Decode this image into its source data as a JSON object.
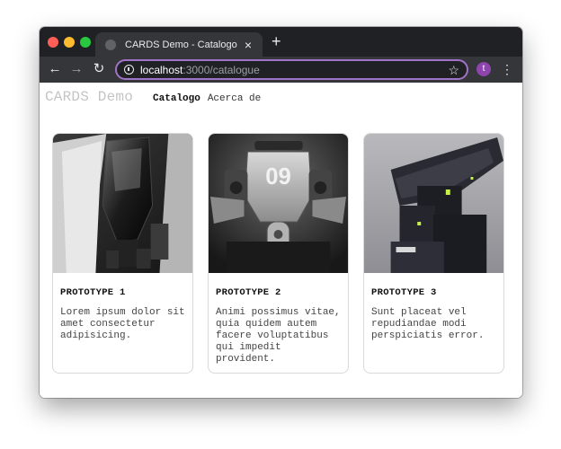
{
  "browser": {
    "tab_title": "CARDS Demo - Catalogo",
    "tab_close": "×",
    "new_tab": "+",
    "url_host": "localhost",
    "url_path": ":3000/catalogue",
    "profile_initial": "t"
  },
  "site": {
    "brand": "CARDS Demo",
    "nav": [
      "Catalogo",
      "Acerca de"
    ]
  },
  "cards": [
    {
      "title": "PROTOTYPE 1",
      "text": "Lorem ipsum dolor sit amet consectetur adipisicing."
    },
    {
      "title": "PROTOTYPE 2",
      "text": "Animi possimus vitae, quia quidem autem facere voluptatibus qui impedit provident."
    },
    {
      "title": "PROTOTYPE 3",
      "text": "Sunt placeat vel repudiandae modi perspiciatis error."
    }
  ],
  "card_images": [
    {
      "label": ""
    },
    {
      "label": "09"
    },
    {
      "label": ""
    }
  ],
  "colors": {
    "omnibox_border": "#a173c8",
    "profile": "#8e44ad"
  }
}
